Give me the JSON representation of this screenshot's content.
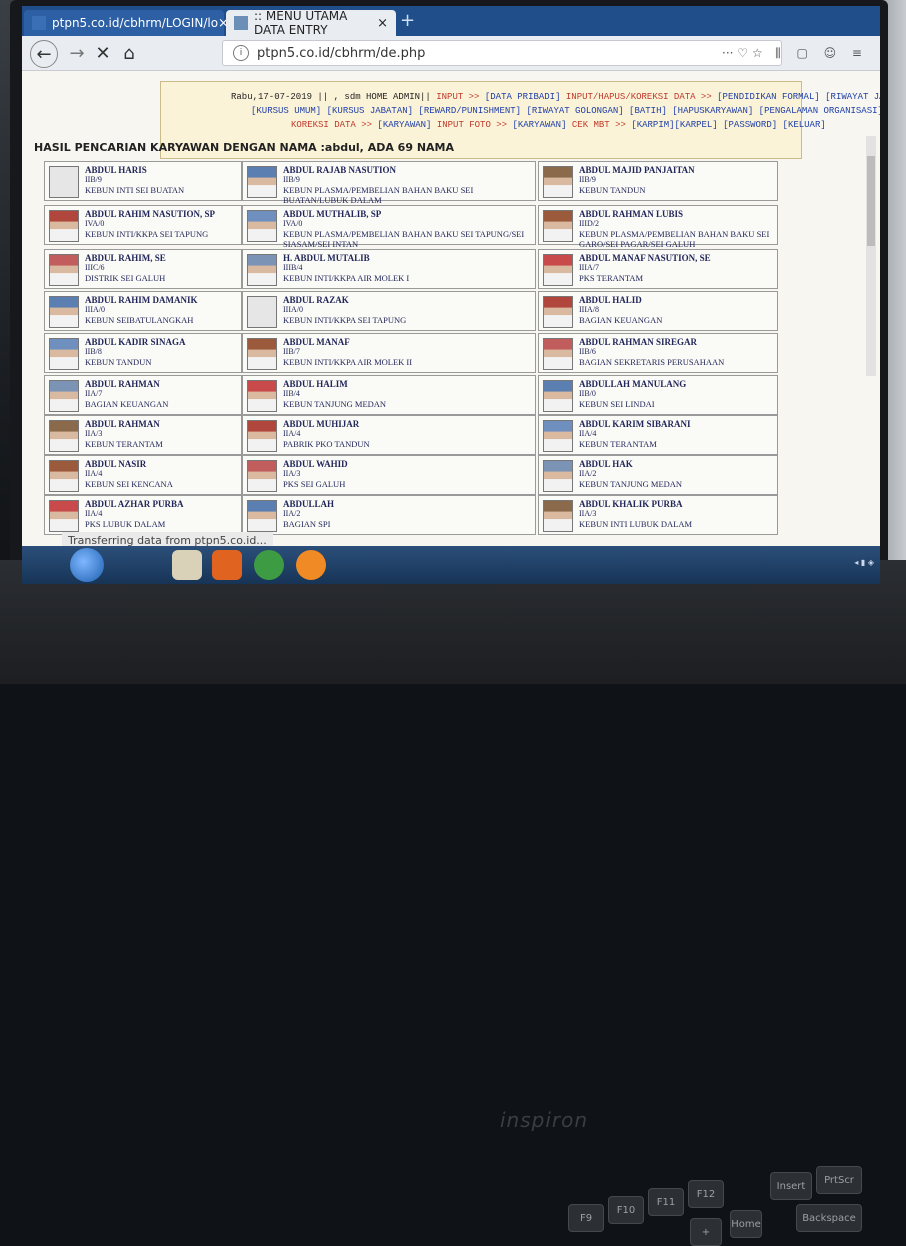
{
  "browser": {
    "tabs": [
      {
        "title": "ptpn5.co.id/cbhrm/LOGIN/lo",
        "close": "×"
      },
      {
        "title": ":: MENU UTAMA DATA ENTRY",
        "close": "×"
      }
    ],
    "new_tab": "+",
    "url": "ptpn5.co.id/cbhrm/de.php",
    "url_actions": "··· ♡ ☆",
    "right_icons": "⫼ ▢ ☺ ≡",
    "status": "Transferring data from ptpn5.co.id..."
  },
  "header": {
    "line1_prefix": "Rabu,17-07-2019 || , sdm HOME ADMIN||",
    "line1_input": "INPUT >>",
    "line1_data_pribadi": "[DATA PRIBADI]",
    "line1_ihk": "INPUT/HAPUS/KOREKSI DATA >>",
    "line1_rest": "[PENDIDIKAN FORMAL] [RIWAYAT JABATAN]",
    "line2": "[KURSUS UMUM] [KURSUS JABATAN] [REWARD/PUNISHMENT] [RIWAYAT GOLONGAN] [BATIH] [HAPUSKARYAWAN] [PENGALAMAN ORGANISASI]",
    "line3_koreksi": "KOREKSI DATA >>",
    "line3_karyawan": "[KARYAWAN]",
    "line3_foto": "INPUT FOTO >>",
    "line3_karyawan2": "[KARYAWAN]",
    "line3_cek": "CEK MBT >>",
    "line3_rest": "[KARPIM][KARPEL] [PASSWORD] [KELUAR]"
  },
  "result_title": "HASIL PENCARIAN KARYAWAN DENGAN NAMA :abdul, ADA 69 NAMA",
  "employees": [
    {
      "name": "ABDUL HARIS",
      "grade": "IIB/9",
      "unit": "KEBUN INTI SEI BUATAN",
      "photo": false
    },
    {
      "name": "ABDUL RAJAB NASUTION",
      "grade": "IIB/9",
      "unit": "KEBUN PLASMA/PEMBELIAN BAHAN BAKU SEI BUATAN/LUBUK DALAM",
      "photo": true
    },
    {
      "name": "ABDUL MAJID PANJAITAN",
      "grade": "IIB/9",
      "unit": "KEBUN TANDUN",
      "photo": true
    },
    {
      "name": "ABDUL RAHIM NASUTION, SP",
      "grade": "IVA/0",
      "unit": "KEBUN INTI/KKPA SEI TAPUNG",
      "photo": true
    },
    {
      "name": "ABDUL MUTHALIB, SP",
      "grade": "IVA/0",
      "unit": "KEBUN PLASMA/PEMBELIAN BAHAN BAKU SEI TAPUNG/SEI SIASAM/SEI INTAN",
      "photo": true
    },
    {
      "name": "ABDUL RAHMAN LUBIS",
      "grade": "IIID/2",
      "unit": "KEBUN PLASMA/PEMBELIAN BAHAN BAKU SEI GARO/SEI PAGAR/SEI GALUH",
      "photo": true
    },
    {
      "name": "ABDUL RAHIM, SE",
      "grade": "IIIC/6",
      "unit": "DISTRIK SEI GALUH",
      "photo": true
    },
    {
      "name": "H. ABDUL MUTALIB",
      "grade": "IIIB/4",
      "unit": "KEBUN INTI/KKPA AIR MOLEK I",
      "photo": true
    },
    {
      "name": "ABDUL MANAF NASUTION, SE",
      "grade": "IIIA/7",
      "unit": "PKS TERANTAM",
      "photo": true
    },
    {
      "name": "ABDUL RAHIM DAMANIK",
      "grade": "IIIA/0",
      "unit": "KEBUN SEIBATULANGKAH",
      "photo": true
    },
    {
      "name": "ABDUL RAZAK",
      "grade": "IIIA/0",
      "unit": "KEBUN INTI/KKPA SEI TAPUNG",
      "photo": false
    },
    {
      "name": "ABDUL HALID",
      "grade": "IIIA/8",
      "unit": "BAGIAN KEUANGAN",
      "photo": true
    },
    {
      "name": "ABDUL KADIR SINAGA",
      "grade": "IIB/8",
      "unit": "KEBUN TANDUN",
      "photo": true
    },
    {
      "name": "ABDUL MANAF",
      "grade": "IIB/7",
      "unit": "KEBUN INTI/KKPA AIR MOLEK II",
      "photo": true
    },
    {
      "name": "ABDUL RAHMAN SIREGAR",
      "grade": "IIB/6",
      "unit": "BAGIAN SEKRETARIS PERUSAHAAN",
      "photo": true
    },
    {
      "name": "ABDUL RAHMAN",
      "grade": "IIA/7",
      "unit": "BAGIAN KEUANGAN",
      "photo": true
    },
    {
      "name": "ABDUL HALIM",
      "grade": "IIB/4",
      "unit": "KEBUN TANJUNG MEDAN",
      "photo": true
    },
    {
      "name": "ABDULLAH MANULANG",
      "grade": "IIB/0",
      "unit": "KEBUN SEI LINDAI",
      "photo": true
    },
    {
      "name": "ABDUL RAHMAN",
      "grade": "IIA/3",
      "unit": "KEBUN TERANTAM",
      "photo": true
    },
    {
      "name": "ABDUL MUHIJAR",
      "grade": "IIA/4",
      "unit": "PABRIK PKO TANDUN",
      "photo": true
    },
    {
      "name": "ABDUL KARIM SIBARANI",
      "grade": "IIA/4",
      "unit": "KEBUN TERANTAM",
      "photo": true
    },
    {
      "name": "ABDUL NASIR",
      "grade": "IIA/4",
      "unit": "KEBUN SEI KENCANA",
      "photo": true
    },
    {
      "name": "ABDUL WAHID",
      "grade": "IIA/3",
      "unit": "PKS SEI GALUH",
      "photo": true
    },
    {
      "name": "ABDUL HAK",
      "grade": "IIA/2",
      "unit": "KEBUN TANJUNG MEDAN",
      "photo": true
    },
    {
      "name": "ABDUL AZHAR PURBA",
      "grade": "IIA/4",
      "unit": "PKS LUBUK DALAM",
      "photo": true
    },
    {
      "name": "ABDULLAH",
      "grade": "IIA/2",
      "unit": "BAGIAN SPI",
      "photo": true
    },
    {
      "name": "ABDUL KHALIK PURBA",
      "grade": "IIA/3",
      "unit": "KEBUN INTI LUBUK DALAM",
      "photo": true
    }
  ],
  "laptop": {
    "brand": "inspiron",
    "keys": [
      "F9",
      "F10",
      "F11",
      "F12",
      "Insert",
      "PrtScr",
      "Backspace",
      "Home",
      "+"
    ]
  },
  "colors": {
    "header_red": "#c0392b",
    "header_blue": "#1f3fa8",
    "name_navy": "#22275a",
    "tab_blue": "#1f4e8a"
  }
}
